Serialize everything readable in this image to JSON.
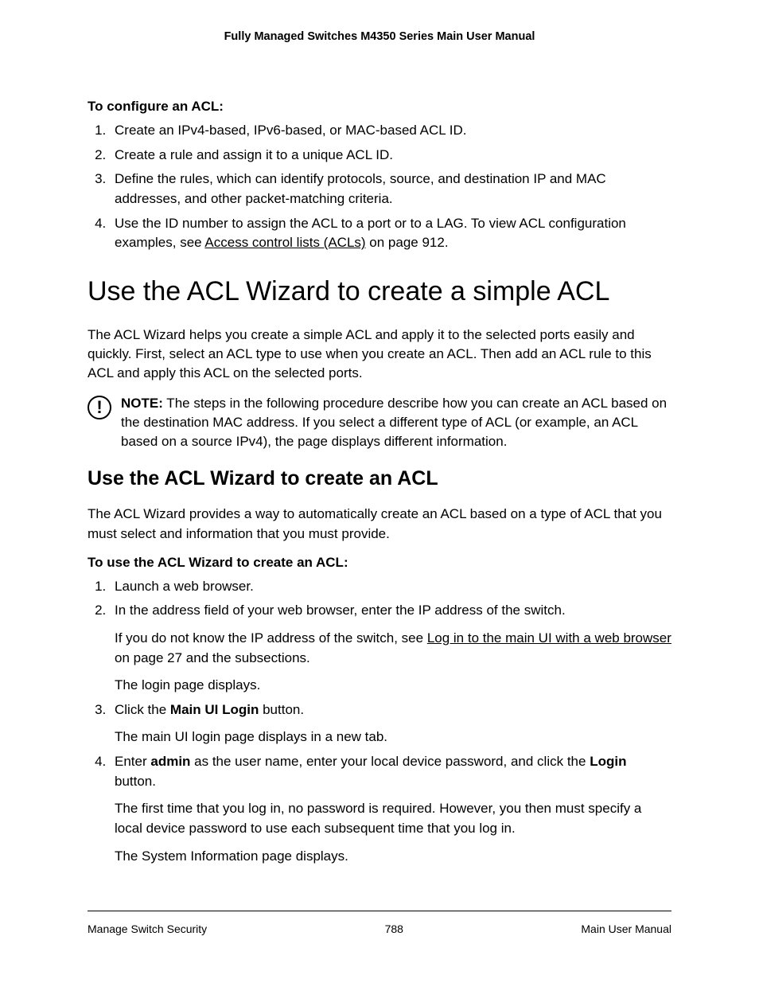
{
  "header": {
    "title": "Fully Managed Switches M4350 Series Main User Manual"
  },
  "section1": {
    "heading": "To configure an ACL:",
    "steps": [
      "Create an IPv4-based, IPv6-based, or MAC-based ACL ID.",
      "Create a rule and assign it to a unique ACL ID.",
      "Define the rules, which can identify protocols, source, and destination IP and MAC addresses, and other packet-matching criteria."
    ],
    "step4_a": "Use the ID number to assign the ACL to a port or to a LAG. To view ACL configuration examples, see ",
    "step4_link": "Access control lists (ACLs)",
    "step4_b": " on page 912."
  },
  "h1": "Use the ACL Wizard to create a simple ACL",
  "intro": "The ACL Wizard helps you create a simple ACL and apply it to the selected ports easily and quickly. First, select an ACL type to use when you create an ACL. Then add an ACL rule to this ACL and apply this ACL on the selected ports.",
  "note": {
    "label": "NOTE:",
    "text": "  The steps in the following procedure describe how you can create an ACL based on the destination MAC address. If you select a different type of ACL (or example, an ACL based on a source IPv4), the page displays different information."
  },
  "h2": "Use the ACL Wizard to create an ACL",
  "para2": "The ACL Wizard provides a way to automatically create an ACL based on a type of ACL that you must select and information that you must provide.",
  "section2": {
    "heading": "To use the ACL Wizard to create an ACL:",
    "step1": "Launch a web browser.",
    "step2": {
      "main": "In the address field of your web browser, enter the IP address of the switch.",
      "sub1_a": "If you do not know the IP address of the switch, see ",
      "sub1_link": "Log in to the main UI with a web browser",
      "sub1_b": " on page 27 and the subsections.",
      "sub2": "The login page displays."
    },
    "step3": {
      "a": "Click the ",
      "bold": "Main UI Login",
      "b": " button.",
      "sub": "The main UI login page displays in a new tab."
    },
    "step4": {
      "a": "Enter ",
      "bold1": "admin",
      "b": " as the user name, enter your local device password, and click the ",
      "bold2": "Login",
      "c": " button.",
      "sub1": "The first time that you log in, no password is required. However, you then must specify a local device password to use each subsequent time that you log in.",
      "sub2": "The System Information page displays."
    }
  },
  "footer": {
    "left": "Manage Switch Security",
    "center": "788",
    "right": "Main User Manual"
  }
}
